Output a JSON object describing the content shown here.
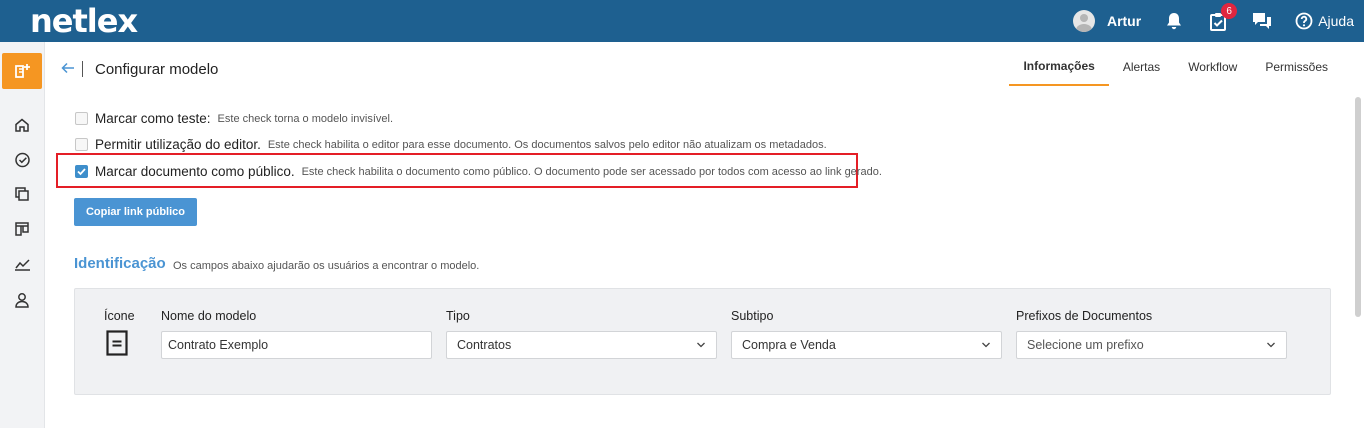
{
  "app": {
    "logo": "netlex"
  },
  "header": {
    "user_name": "Artur",
    "tasks_badge": "6",
    "help_label": "Ajuda"
  },
  "page": {
    "title": "Configurar modelo"
  },
  "tabs": [
    {
      "label": "Informações",
      "active": true
    },
    {
      "label": "Alertas",
      "active": false
    },
    {
      "label": "Workflow",
      "active": false
    },
    {
      "label": "Permissões",
      "active": false
    }
  ],
  "options": [
    {
      "label": "Marcar como teste:",
      "description": "Este check torna o modelo invisível.",
      "checked": false
    },
    {
      "label": "Permitir utilização do editor.",
      "description": "Este check habilita o editor para esse documento. Os documentos salvos pelo editor não atualizam os metadados.",
      "checked": false
    },
    {
      "label": "Marcar documento como público.",
      "description": "Este check habilita o documento como público. O documento pode ser acessado por todos com acesso ao link gerado.",
      "checked": true
    }
  ],
  "copy_button": "Copiar link público",
  "identificacao": {
    "title": "Identificação",
    "description": "Os campos abaixo ajudarão os usuários a encontrar o modelo.",
    "icon_label": "Ícone",
    "name_label": "Nome do modelo",
    "name_value": "Contrato Exemplo",
    "tipo_label": "Tipo",
    "tipo_value": "Contratos",
    "subtipo_label": "Subtipo",
    "subtipo_value": "Compra e Venda",
    "prefixos_label": "Prefixos de Documentos",
    "prefixos_placeholder": "Selecione um prefixo"
  },
  "colors": {
    "topbar": "#1e6090",
    "accent": "#f59622",
    "primary": "#4a94d3",
    "highlight": "#e41e26"
  }
}
